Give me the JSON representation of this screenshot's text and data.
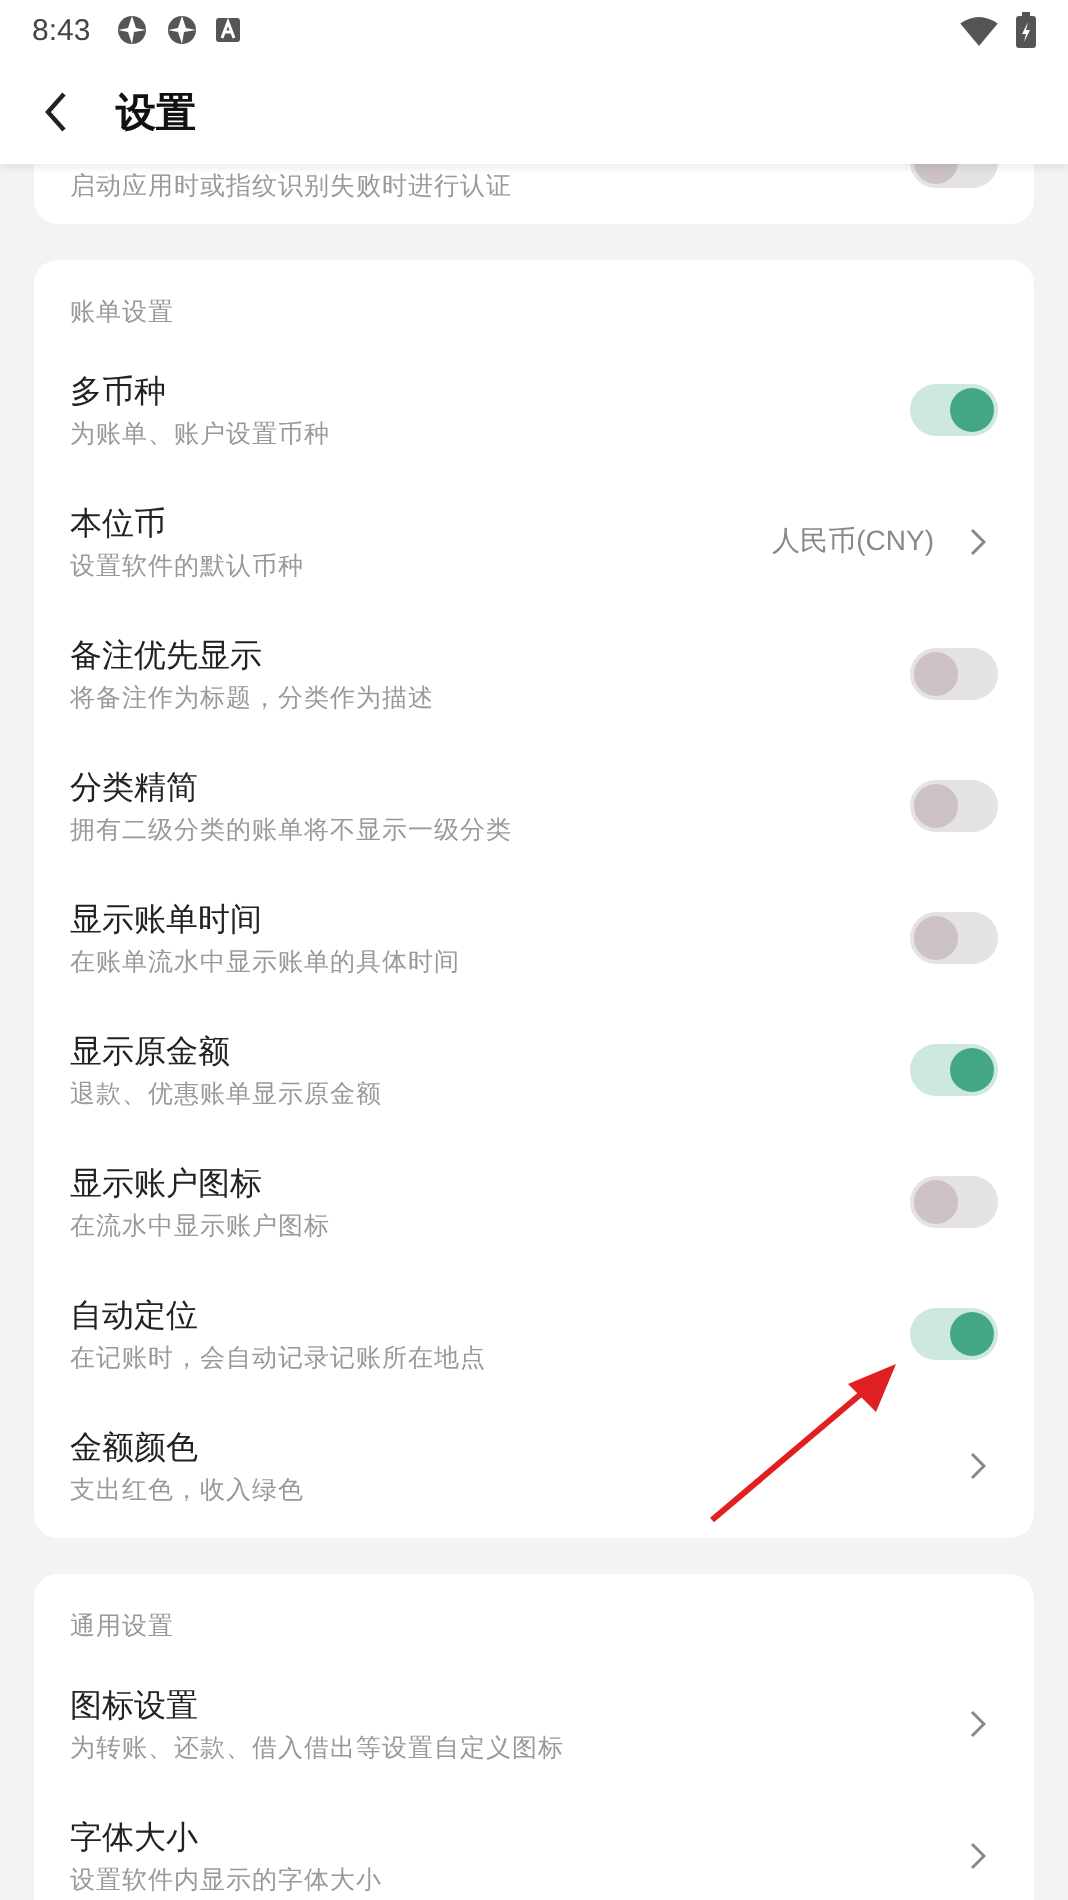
{
  "status_bar": {
    "time": "8:43"
  },
  "header": {
    "title": "设置"
  },
  "sections": [
    {
      "rows": [
        {
          "kind": "toggle",
          "subtitle": "启动应用时或指纹识别失败时进行认证",
          "on": false
        }
      ]
    },
    {
      "label": "账单设置",
      "rows": [
        {
          "kind": "toggle",
          "title": "多币种",
          "subtitle": "为账单、账户设置币种",
          "on": true
        },
        {
          "kind": "link",
          "title": "本位币",
          "subtitle": "设置软件的默认币种",
          "value": "人民币(CNY)"
        },
        {
          "kind": "toggle",
          "title": "备注优先显示",
          "subtitle": "将备注作为标题，分类作为描述",
          "on": false
        },
        {
          "kind": "toggle",
          "title": "分类精简",
          "subtitle": "拥有二级分类的账单将不显示一级分类",
          "on": false
        },
        {
          "kind": "toggle",
          "title": "显示账单时间",
          "subtitle": "在账单流水中显示账单的具体时间",
          "on": false
        },
        {
          "kind": "toggle",
          "title": "显示原金额",
          "subtitle": "退款、优惠账单显示原金额",
          "on": true
        },
        {
          "kind": "toggle",
          "title": "显示账户图标",
          "subtitle": "在流水中显示账户图标",
          "on": false
        },
        {
          "kind": "toggle",
          "title": "自动定位",
          "subtitle": "在记账时，会自动记录记账所在地点",
          "on": true
        },
        {
          "kind": "link",
          "title": "金额颜色",
          "subtitle": "支出红色，收入绿色"
        }
      ]
    },
    {
      "label": "通用设置",
      "rows": [
        {
          "kind": "link",
          "title": "图标设置",
          "subtitle": "为转账、还款、借入借出等设置自定义图标"
        },
        {
          "kind": "link",
          "title": "字体大小",
          "subtitle": "设置软件内显示的字体大小"
        }
      ]
    }
  ]
}
